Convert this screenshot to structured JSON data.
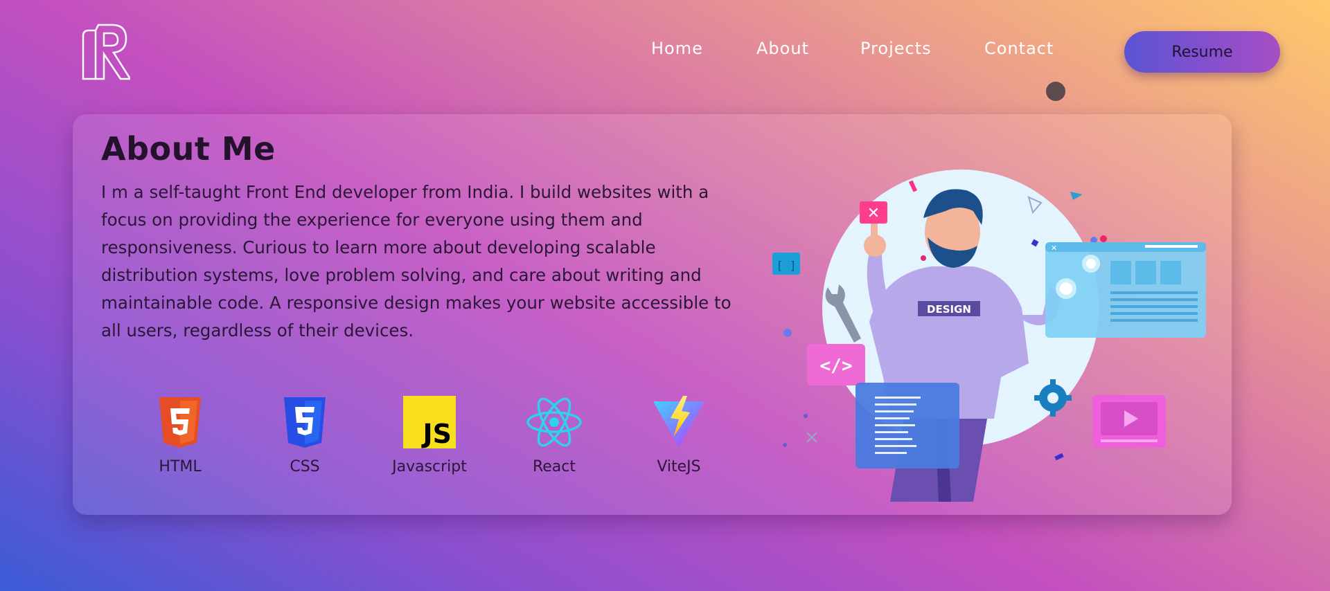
{
  "nav": {
    "logo_icon": "r-monogram-logo",
    "links": [
      "Home",
      "About",
      "Projects",
      "Contact"
    ],
    "resume_label": "Resume"
  },
  "about": {
    "title": "About Me",
    "bio": "I m a self-taught Front End developer from India. I build websites with a focus on providing the experience for everyone using them and responsiveness. Curious to learn more about developing scalable distribution systems, love problem solving, and care about writing and maintainable code. A responsive design makes your website accessible to all users, regardless of their devices.",
    "skills": [
      {
        "label": "HTML",
        "icon": "html5-icon"
      },
      {
        "label": "CSS",
        "icon": "css3-icon"
      },
      {
        "label": "Javascript",
        "icon": "javascript-icon"
      },
      {
        "label": "React",
        "icon": "react-icon"
      },
      {
        "label": "ViteJS",
        "icon": "vitejs-icon"
      }
    ],
    "illustration": {
      "shirt_text": "DESIGN",
      "icon": "developer-illustration"
    }
  },
  "colors": {
    "accent": "#8a4fcc",
    "html": "#e44d26",
    "css": "#264de4",
    "js": "#f7df1e",
    "react": "#2fd0f0"
  }
}
